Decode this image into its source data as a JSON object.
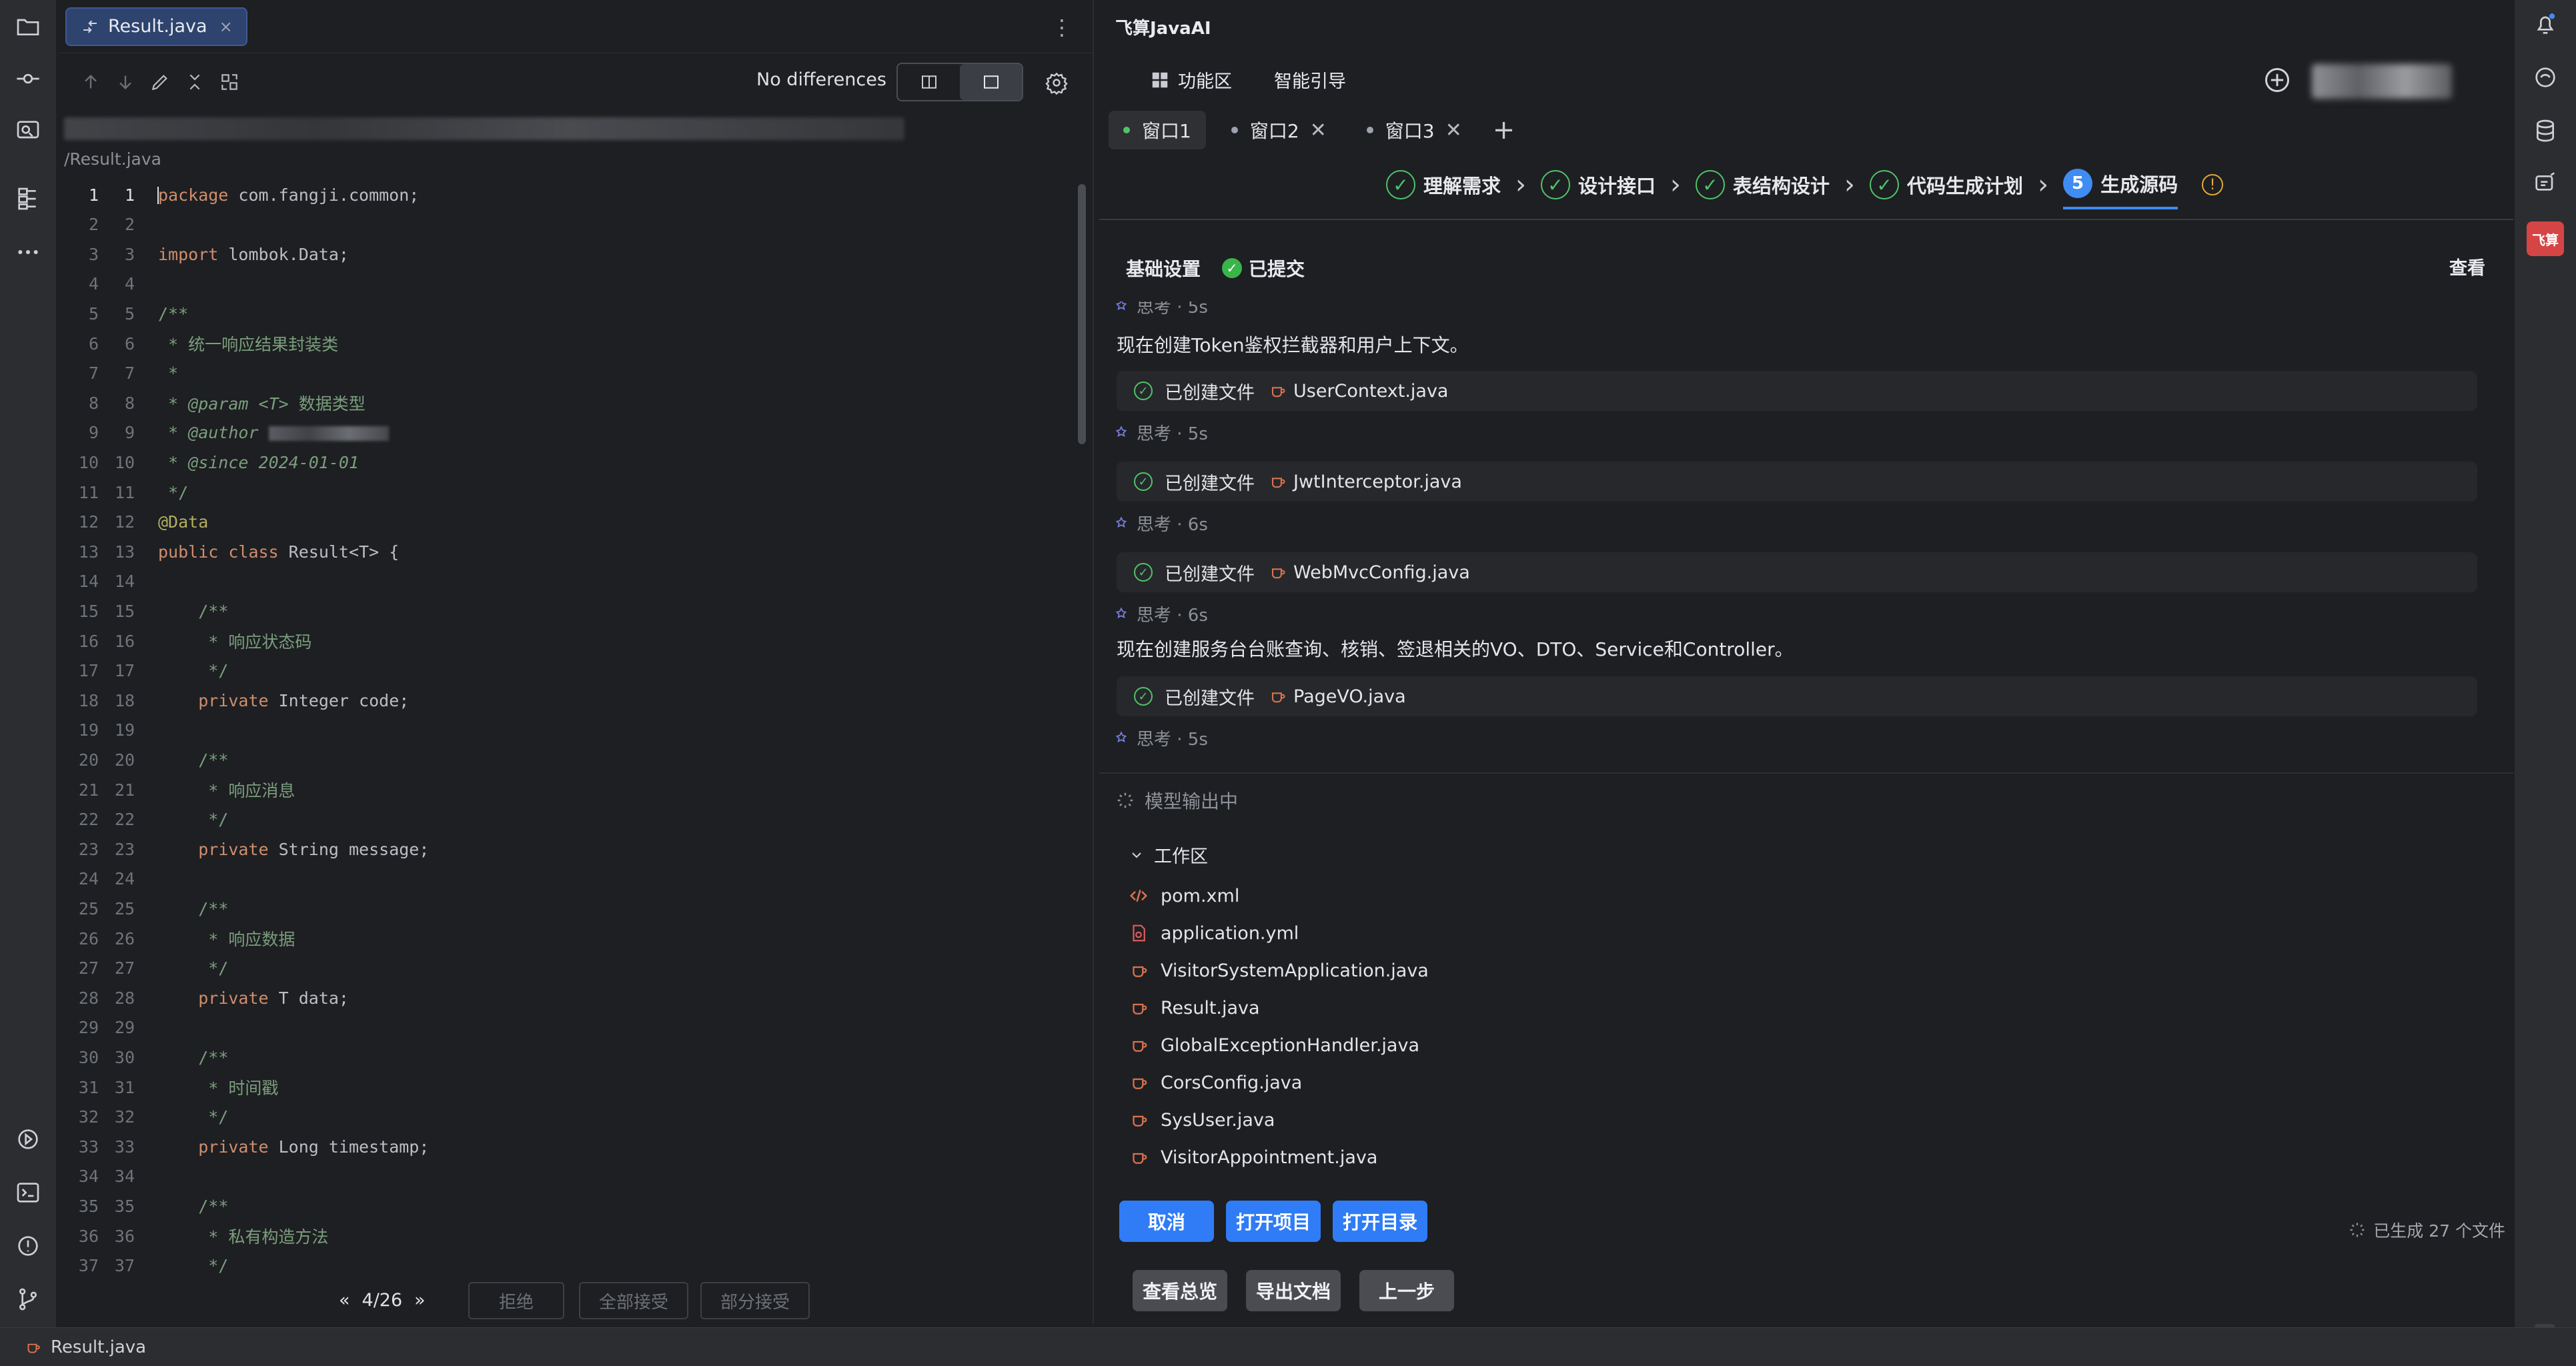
{
  "editor": {
    "tab_label": "Result.java",
    "tab_close": "×",
    "kebab": "⋮",
    "no_diff": "No differences",
    "file_path": "/Result.java",
    "pager": "4/26",
    "pager_prev": "«",
    "pager_next": "»",
    "reject": "拒绝",
    "accept_all": "全部接受",
    "accept_part": "部分接受",
    "lines": [
      {
        "n": "1",
        "html": "<span class=\"kw\">package</span> com.fangji.common;"
      },
      {
        "n": "2",
        "html": ""
      },
      {
        "n": "3",
        "html": "<span class=\"kw\">import</span> lombok.Data;"
      },
      {
        "n": "4",
        "html": ""
      },
      {
        "n": "5",
        "html": "<span class=\"cm\">/**</span>"
      },
      {
        "n": "6",
        "html": "<span class=\"cm\"> * 统一响应结果封装类</span>"
      },
      {
        "n": "7",
        "html": "<span class=\"cm\"> *</span>"
      },
      {
        "n": "8",
        "html": "<span class=\"cm\"> * </span><span class=\"tag\">@param</span><span class=\"cm\"> &lt;</span><span class=\"tag\">T</span><span class=\"cm\">&gt; 数据类型</span>"
      },
      {
        "n": "9",
        "html": "<span class=\"cm\"> * </span><span class=\"tag\">@author</span><span class=\"cm\"> </span><span class=\"blur-txt\"></span>"
      },
      {
        "n": "10",
        "html": "<span class=\"cm\"> * </span><span class=\"tag\">@since</span><span class=\"tag\"> 2024-01-01</span>"
      },
      {
        "n": "11",
        "html": "<span class=\"cm\"> */</span>"
      },
      {
        "n": "12",
        "html": "<span class=\"ann\">@Data</span>"
      },
      {
        "n": "13",
        "html": "<span class=\"kw\">public class</span> Result&lt;T&gt; {"
      },
      {
        "n": "14",
        "html": ""
      },
      {
        "n": "15",
        "html": "    <span class=\"cm\">/**</span>"
      },
      {
        "n": "16",
        "html": "<span class=\"cm\">     * 响应状态码</span>"
      },
      {
        "n": "17",
        "html": "<span class=\"cm\">     */</span>"
      },
      {
        "n": "18",
        "html": "    <span class=\"kw\">private</span> Integer code;"
      },
      {
        "n": "19",
        "html": ""
      },
      {
        "n": "20",
        "html": "    <span class=\"cm\">/**</span>"
      },
      {
        "n": "21",
        "html": "<span class=\"cm\">     * 响应消息</span>"
      },
      {
        "n": "22",
        "html": "<span class=\"cm\">     */</span>"
      },
      {
        "n": "23",
        "html": "    <span class=\"kw\">private</span> String message;"
      },
      {
        "n": "24",
        "html": ""
      },
      {
        "n": "25",
        "html": "    <span class=\"cm\">/**</span>"
      },
      {
        "n": "26",
        "html": "<span class=\"cm\">     * 响应数据</span>"
      },
      {
        "n": "27",
        "html": "<span class=\"cm\">     */</span>"
      },
      {
        "n": "28",
        "html": "    <span class=\"kw\">private</span> T data;"
      },
      {
        "n": "29",
        "html": ""
      },
      {
        "n": "30",
        "html": "    <span class=\"cm\">/**</span>"
      },
      {
        "n": "31",
        "html": "<span class=\"cm\">     * 时间戳</span>"
      },
      {
        "n": "32",
        "html": "<span class=\"cm\">     */</span>"
      },
      {
        "n": "33",
        "html": "    <span class=\"kw\">private</span> Long timestamp;"
      },
      {
        "n": "34",
        "html": ""
      },
      {
        "n": "35",
        "html": "    <span class=\"cm\">/**</span>"
      },
      {
        "n": "36",
        "html": "<span class=\"cm\">     * 私有构造方法</span>"
      },
      {
        "n": "37",
        "html": "<span class=\"cm\">     */</span>"
      }
    ]
  },
  "ai": {
    "title": "飞算JavaAI",
    "nav": {
      "features": "功能区",
      "guide": "智能引导"
    },
    "windows": [
      {
        "label": "窗口1",
        "active": true,
        "closable": false
      },
      {
        "label": "窗口2",
        "active": false,
        "closable": true
      },
      {
        "label": "窗口3",
        "active": false,
        "closable": true
      }
    ],
    "window_add": "+",
    "window_close": "✕",
    "steps": [
      {
        "label": "理解需求",
        "done": true
      },
      {
        "label": "设计接口",
        "done": true
      },
      {
        "label": "表结构设计",
        "done": true
      },
      {
        "label": "代码生成计划",
        "done": true
      },
      {
        "label": "生成源码",
        "done": false,
        "num": "5"
      }
    ],
    "step_sep": "›",
    "basic_settings": "基础设置",
    "submitted": "已提交",
    "view": "查看",
    "log": {
      "think_top": "思考 · 5s",
      "msg1": "现在创建Token鉴权拦截器和用户上下文。",
      "created": "已创建文件",
      "files": [
        "UserContext.java",
        "JwtInterceptor.java",
        "WebMvcConfig.java",
        "PageVO.java"
      ],
      "thinks": [
        "思考 · 5s",
        "思考 · 6s",
        "思考 · 6s",
        "思考 · 5s"
      ],
      "msg2": "现在创建服务台台账查询、核销、签退相关的VO、DTO、Service和Controller。"
    },
    "model_output": "模型输出中",
    "workspace_label": "工作区",
    "workspace_files": [
      {
        "name": "pom.xml",
        "type": "xml"
      },
      {
        "name": "application.yml",
        "type": "yml"
      },
      {
        "name": "VisitorSystemApplication.java",
        "type": "java"
      },
      {
        "name": "Result.java",
        "type": "java"
      },
      {
        "name": "GlobalExceptionHandler.java",
        "type": "java"
      },
      {
        "name": "CorsConfig.java",
        "type": "java"
      },
      {
        "name": "SysUser.java",
        "type": "java"
      },
      {
        "name": "VisitorAppointment.java",
        "type": "java"
      }
    ],
    "buttons": {
      "cancel": "取消",
      "open_project": "打开项目",
      "open_dir": "打开目录",
      "overview": "查看总览",
      "export": "导出文档",
      "prev": "上一步"
    },
    "generated": "已生成 27 个文件"
  },
  "status": {
    "file": "Result.java"
  },
  "colors": {
    "accent": "#2f7cf6",
    "success": "#4fc36a",
    "java": "#d9734e",
    "warning": "#e0a938"
  }
}
